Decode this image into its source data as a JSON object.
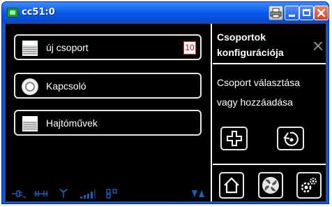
{
  "window": {
    "title": "cc51:0",
    "buttons": [
      "print",
      "minimize",
      "maximize",
      "close"
    ]
  },
  "groups": [
    {
      "label": "új csoport",
      "icon": "blind-icon",
      "badge": "10"
    },
    {
      "label": "Kapcsoló",
      "icon": "switch-icon"
    },
    {
      "label": "Hajtóművek",
      "icon": "blind-icon"
    }
  ],
  "panel": {
    "title": "Csoportok konfigurációja",
    "description": "Csoport választása vagy hozzáadása"
  },
  "status_icons": [
    "plug-icon",
    "network-icon",
    "antenna-icon",
    "signal-bars-icon",
    "grid-icon",
    "sort-arrows-icon"
  ],
  "colors": {
    "titlebar": "#0a55e6",
    "background": "#000000",
    "accent": "#1a5fbf",
    "badge_border": "#ff2a2a"
  }
}
